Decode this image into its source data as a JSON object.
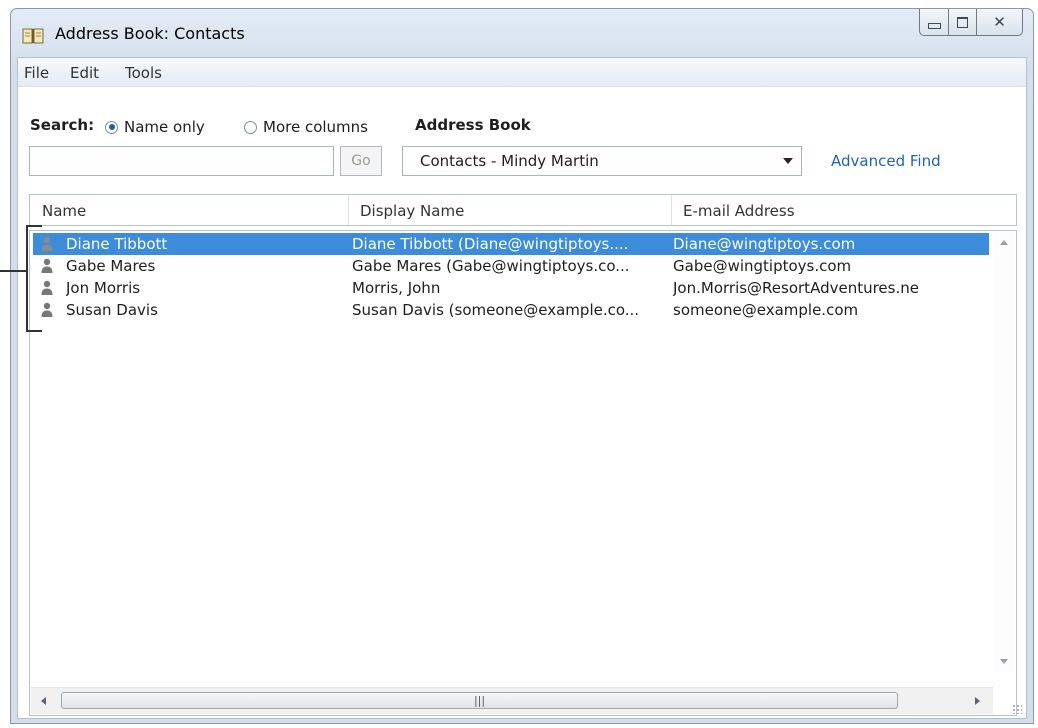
{
  "window": {
    "title": "Address Book: Contacts"
  },
  "menu": [
    "File",
    "Edit",
    "Tools"
  ],
  "search": {
    "label": "Search:",
    "option_name_only": "Name only",
    "option_more_columns": "More columns",
    "selected": "Name only",
    "value": "",
    "go_label": "Go"
  },
  "address_book": {
    "label": "Address Book",
    "selected": "Contacts - Mindy Martin",
    "advanced_find": "Advanced Find"
  },
  "columns": [
    "Name",
    "Display Name",
    "E-mail Address"
  ],
  "contacts": [
    {
      "name": "Diane Tibbott",
      "display": "Diane Tibbott (Diane@wingtiptoys....",
      "email": "Diane@wingtiptoys.com",
      "selected": true
    },
    {
      "name": "Gabe Mares",
      "display": "Gabe Mares (Gabe@wingtiptoys.co...",
      "email": "Gabe@wingtiptoys.com",
      "selected": false
    },
    {
      "name": "Jon Morris",
      "display": "Morris, John",
      "email": "Jon.Morris@ResortAdventures.ne",
      "selected": false
    },
    {
      "name": "Susan Davis",
      "display": "Susan Davis (someone@example.co...",
      "email": "someone@example.com",
      "selected": false
    }
  ],
  "colors": {
    "selection": "#3c8cda",
    "link": "#1f63b5"
  },
  "icons": {
    "app": "address-book-icon",
    "contact": "person-icon"
  }
}
